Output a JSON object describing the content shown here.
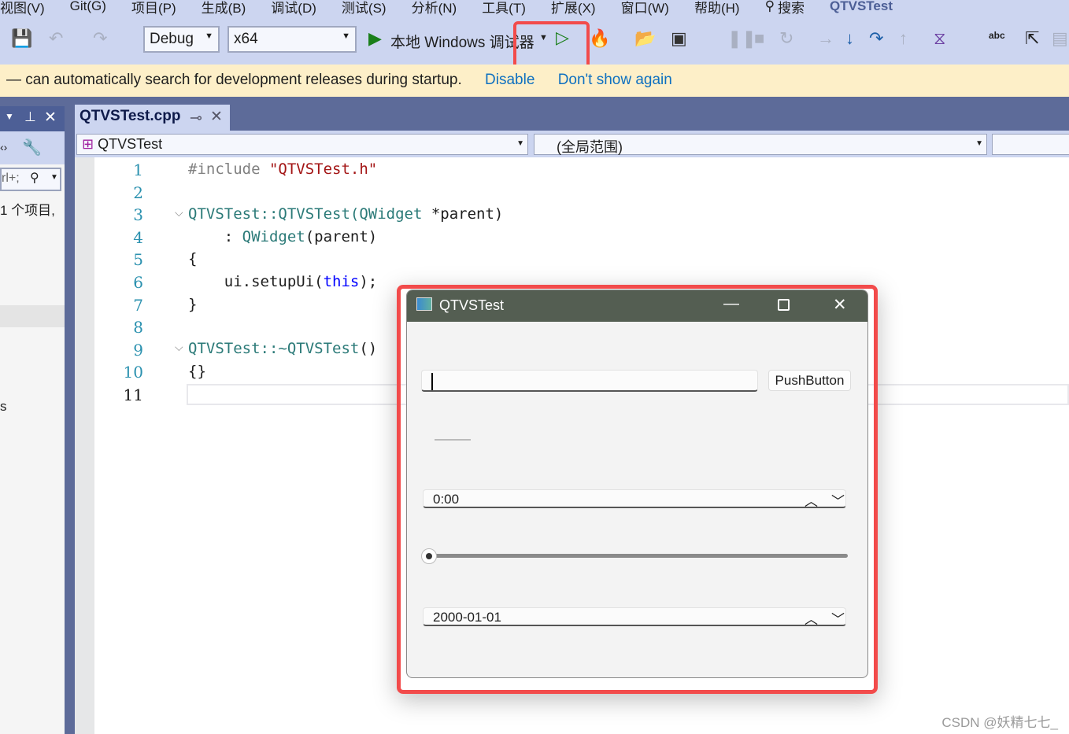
{
  "menu": [
    "视图(V)",
    "Git(G)",
    "项目(P)",
    "生成(B)",
    "调试(D)",
    "测试(S)",
    "分析(N)",
    "工具(T)",
    "扩展(X)",
    "窗口(W)",
    "帮助(H)"
  ],
  "search_label": "搜索",
  "solution_name": "QTVSTest",
  "toolbar": {
    "config": "Debug",
    "platform": "x64",
    "run_label": "本地 Windows 调试器"
  },
  "infobar": {
    "message": "— can automatically search for development releases during startup.",
    "disable": "Disable",
    "dont_show": "Don't show again"
  },
  "left_panel": {
    "search_hint": "rl+;",
    "items_count": "1 个项目,",
    "fragment": "s"
  },
  "tab": {
    "title": "QTVSTest.cpp"
  },
  "navbar": {
    "scope1": "QTVSTest",
    "scope2": "(全局范围)"
  },
  "code": {
    "line_numbers": [
      "1",
      "2",
      "3",
      "4",
      "5",
      "6",
      "7",
      "8",
      "9",
      "10",
      "11"
    ]
  },
  "qt": {
    "title": "QTVSTest",
    "line_edit": "",
    "button": "PushButton",
    "time": "0:00",
    "slider_value": 0,
    "date": "2000-01-01"
  },
  "watermark": "CSDN @妖精七七_",
  "colors": {
    "highlight": "#f24b4b",
    "titlebar": "#545e52",
    "accent": "#0e70c0"
  }
}
